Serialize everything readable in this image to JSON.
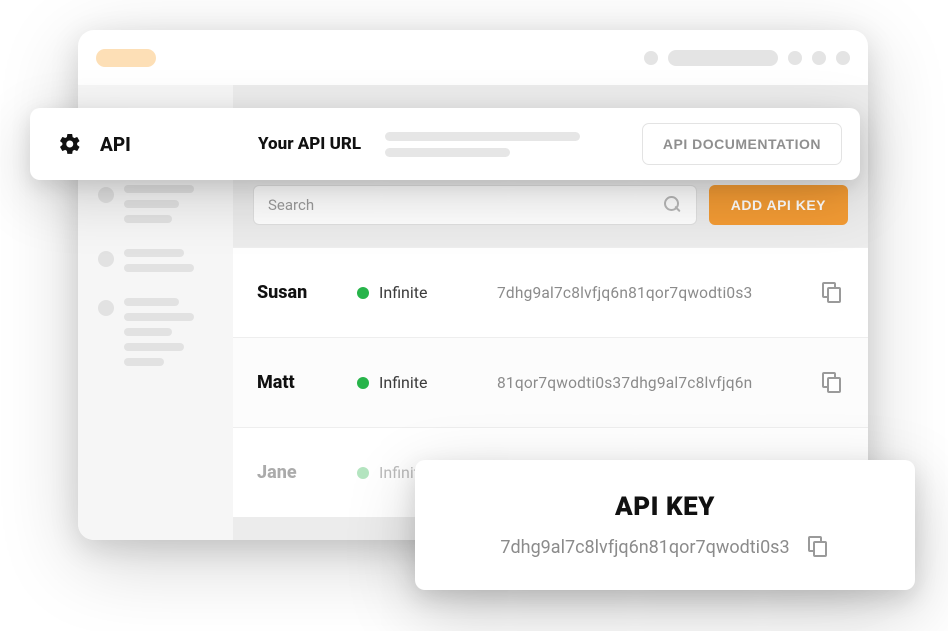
{
  "header": {
    "api_title": "API",
    "url_label": "Your API URL",
    "doc_button": "API DOCUMENTATION"
  },
  "search": {
    "placeholder": "Search",
    "add_button": "ADD API KEY"
  },
  "rows": [
    {
      "name": "Susan",
      "status": "Infinite",
      "key": "7dhg9al7c8lvfjq6n81qor7qwodti0s3",
      "active": true
    },
    {
      "name": "Matt",
      "status": "Infinite",
      "key": "81qor7qwodti0s37dhg9al7c8lvfjq6n",
      "active": true
    },
    {
      "name": "Jane",
      "status": "Infinite",
      "key": "",
      "active": false
    }
  ],
  "popover": {
    "title": "API KEY",
    "key": "7dhg9al7c8lvfjq6n81qor7qwodti0s3"
  },
  "colors": {
    "accent": "#f39b34",
    "status_green": "#27b44a"
  }
}
